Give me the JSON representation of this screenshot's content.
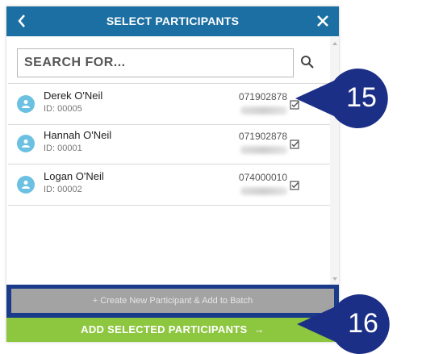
{
  "header": {
    "title": "SELECT PARTICIPANTS",
    "back_icon": "chevron-left-icon",
    "close_icon": "close-icon"
  },
  "search": {
    "placeholder": "SEARCH FOR...",
    "icon": "search-icon"
  },
  "participants": [
    {
      "name": "Derek O'Neil",
      "id": "ID: 00005",
      "phone": "071902878",
      "checked": true
    },
    {
      "name": "Hannah O'Neil",
      "id": "ID: 00001",
      "phone": "071902878",
      "checked": true
    },
    {
      "name": "Logan O'Neil",
      "id": "ID: 00002",
      "phone": "074000010",
      "checked": true
    }
  ],
  "actions": {
    "create_label": "+  Create New Participant & Add to Batch",
    "add_label": "ADD SELECTED PARTICIPANTS",
    "add_arrow": "→"
  },
  "callouts": [
    "15",
    "16"
  ],
  "colors": {
    "header": "#1c6fa3",
    "avatar": "#6cc0e2",
    "add_button": "#8dc63f",
    "create_border": "#1a3a8a",
    "callout": "#1c2f86"
  }
}
